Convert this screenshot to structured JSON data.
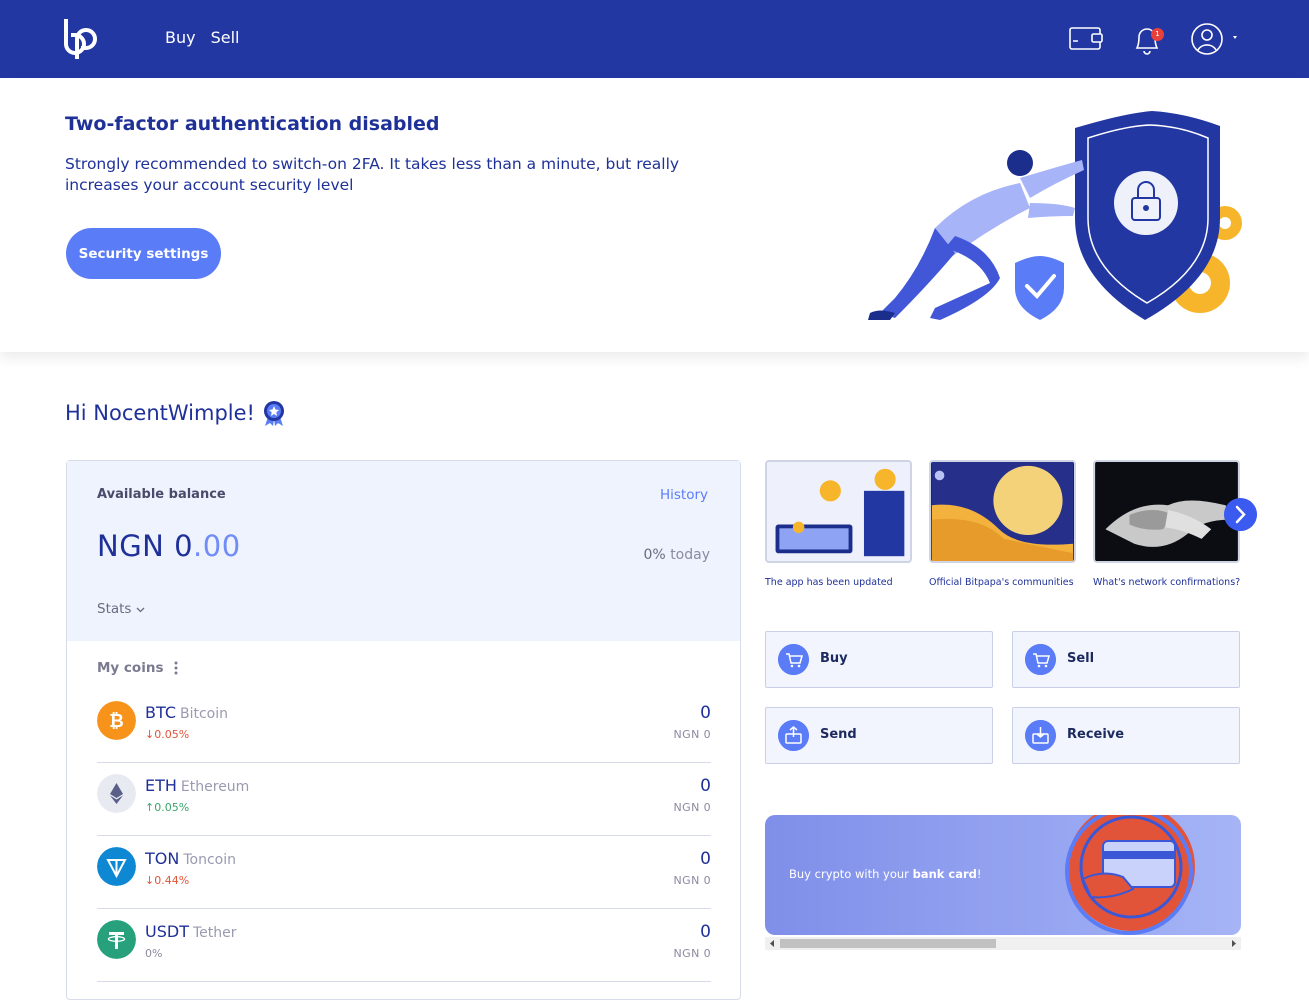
{
  "header": {
    "nav": [
      "Buy",
      "Sell"
    ],
    "notification_count": "1"
  },
  "banner": {
    "title": "Two-factor authentication disabled",
    "text": "Strongly recommended to switch-on 2FA. It takes less than a minute, but really increases your account security level",
    "button": "Security settings"
  },
  "greeting": "Hi NocentWimple!",
  "balance": {
    "label": "Available balance",
    "history": "History",
    "currency": "NGN",
    "amount_int": "0",
    "amount_dec": ".00",
    "change": "0%",
    "change_period": "today",
    "stats": "Stats"
  },
  "coins": {
    "title": "My coins",
    "items": [
      {
        "symbol": "BTC",
        "name": "Bitcoin",
        "change": "↓0.05%",
        "value": "0",
        "ngn": "NGN 0"
      },
      {
        "symbol": "ETH",
        "name": "Ethereum",
        "change": "↑0.05%",
        "value": "0",
        "ngn": "NGN 0"
      },
      {
        "symbol": "TON",
        "name": "Toncoin",
        "change": "↓0.44%",
        "value": "0",
        "ngn": "NGN 0"
      },
      {
        "symbol": "USDT",
        "name": "Tether",
        "change": "0%",
        "value": "0",
        "ngn": "NGN 0"
      }
    ]
  },
  "news": [
    {
      "caption": "The app has been updated"
    },
    {
      "caption": "Official Bitpapa's communities"
    },
    {
      "caption": "What's network confirmations?"
    }
  ],
  "actions": [
    "Buy",
    "Sell",
    "Send",
    "Receive"
  ],
  "promo": {
    "prefix": "Buy crypto with your ",
    "bold": "bank card",
    "suffix": "!"
  },
  "colors": {
    "primary": "#2337a3",
    "accent": "#5b7cf7",
    "btc": "#f7931a",
    "ton": "#0e88d3",
    "usdt": "#26a17b"
  }
}
